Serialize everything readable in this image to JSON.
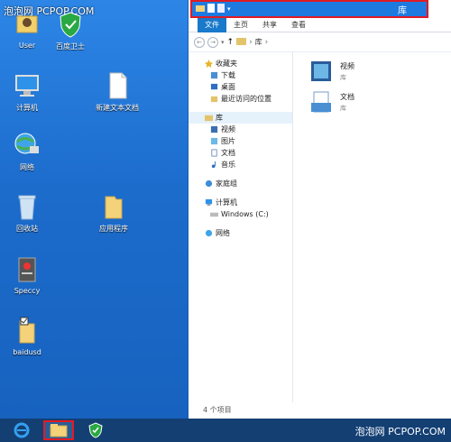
{
  "watermark_top": "泡泡网 PCPOP.COM",
  "watermark_bottom": "泡泡网 PCPOP.COM",
  "desktop_icons": [
    {
      "label": "User",
      "icon": "user-folder-icon"
    },
    {
      "label": "百度卫士",
      "icon": "shield-icon"
    },
    {
      "label": "计算机",
      "icon": "computer-icon"
    },
    {
      "label": "新建文本文档",
      "icon": "text-document-icon"
    },
    {
      "label": "网络",
      "icon": "network-icon"
    },
    {
      "label": "回收站",
      "icon": "recycle-bin-icon"
    },
    {
      "label": "应用程序",
      "icon": "folder-icon"
    },
    {
      "label": "Speccy",
      "icon": "speccy-icon"
    },
    {
      "label": "baidusd",
      "icon": "folder-icon"
    }
  ],
  "explorer": {
    "title": "库",
    "ribbon_tabs": [
      "文件",
      "主页",
      "共享",
      "查看"
    ],
    "address": {
      "path": "库"
    },
    "nav": {
      "favorites": "收藏夹",
      "fav_items": [
        "下载",
        "桌面",
        "最近访问的位置"
      ],
      "libraries": "库",
      "lib_items": [
        "视频",
        "图片",
        "文档",
        "音乐"
      ],
      "homegroup": "家庭组",
      "computer": "计算机",
      "computer_items": [
        "Windows (C:)"
      ],
      "network": "网络"
    },
    "content": [
      {
        "name": "视频",
        "sub": "库"
      },
      {
        "name": "文档",
        "sub": "库"
      }
    ],
    "status": "4 个项目"
  },
  "taskbar": {
    "items": [
      "ie-icon",
      "file-explorer-icon",
      "baidu-guard-icon"
    ]
  }
}
